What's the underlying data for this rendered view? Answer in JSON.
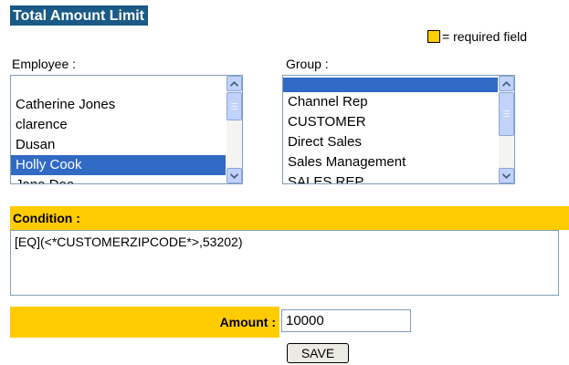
{
  "page": {
    "title": "Total Amount Limit"
  },
  "legend": {
    "text": "= required field",
    "swatch_color": "#ffcc00"
  },
  "employee": {
    "label": "Employee :",
    "items": [
      {
        "label": ""
      },
      {
        "label": "Catherine Jones"
      },
      {
        "label": "clarence"
      },
      {
        "label": "Dusan"
      },
      {
        "label": "Holly Cook",
        "selected": true
      },
      {
        "label": "Jane Doe"
      }
    ]
  },
  "group": {
    "label": "Group :",
    "items": [
      {
        "label": "",
        "selected": true
      },
      {
        "label": "Channel Rep"
      },
      {
        "label": "CUSTOMER"
      },
      {
        "label": "Direct Sales"
      },
      {
        "label": "Sales Management"
      },
      {
        "label": "SALES REP"
      }
    ]
  },
  "condition": {
    "label": "Condition :",
    "value": "[EQ](<*CUSTOMERZIPCODE*>,53202)"
  },
  "amount": {
    "label": "Amount :",
    "value": "10000"
  },
  "actions": {
    "save_label": "SAVE"
  },
  "colors": {
    "title_bg": "#1a5a86",
    "required_bg": "#ffcc00",
    "selection_bg": "#316ac5",
    "field_border": "#7f9db9",
    "scrollbar": "#c1d3fb"
  }
}
